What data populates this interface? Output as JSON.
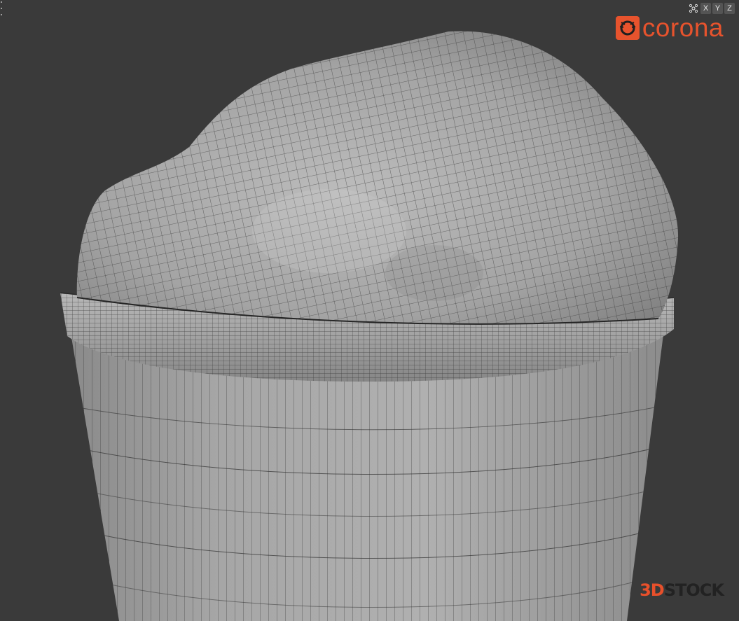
{
  "viewport": {
    "background": "#3a3a3a",
    "mesh_color": "#a9a9a9",
    "wire_color": "#2e2e2e"
  },
  "toolbar": {
    "gizmo_icon": "orientation-gizmo-icon",
    "axes": [
      "X",
      "Y",
      "Z"
    ]
  },
  "branding": {
    "renderer_logo": "corona",
    "renderer_color": "#e7532d",
    "watermark_prefix": "3D",
    "watermark_suffix": "STOCK",
    "watermark_prefix_color": "#e8502b",
    "watermark_suffix_color": "#222222"
  }
}
